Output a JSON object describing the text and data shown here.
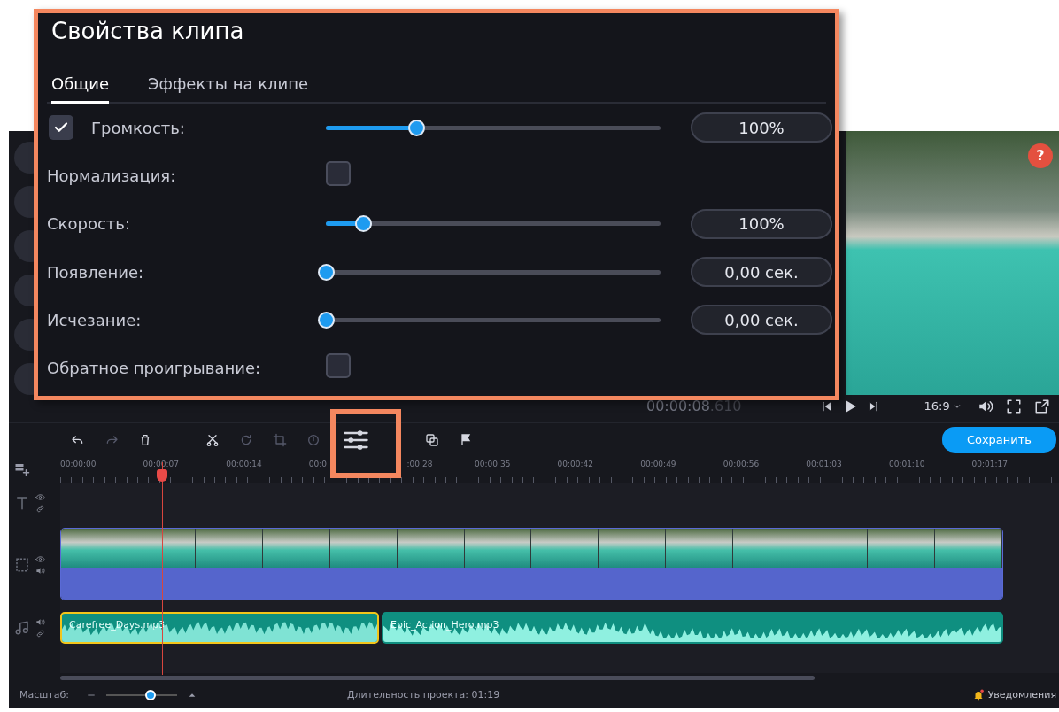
{
  "clip_properties": {
    "title": "Свойства клипа",
    "tabs": [
      {
        "label": "Общие",
        "selected": true
      },
      {
        "label": "Эффекты на клипе",
        "selected": false
      }
    ],
    "rows": [
      {
        "kind": "checkbox-slider",
        "label": "Громкость:",
        "checked": true,
        "level": 0.27,
        "value": "100%"
      },
      {
        "kind": "checkbox",
        "label": "Нормализация:",
        "checked": false
      },
      {
        "kind": "slider",
        "label": "Скорость:",
        "level": 0.11,
        "value": "100%"
      },
      {
        "kind": "slider",
        "label": "Появление:",
        "level": 0,
        "value": "0,00 сек."
      },
      {
        "kind": "slider",
        "label": "Исчезание:",
        "level": 0,
        "value": "0,00 сек."
      },
      {
        "kind": "checkbox",
        "label": "Обратное проигрывание:",
        "checked": false
      }
    ]
  },
  "preview": {
    "help": "?"
  },
  "player": {
    "time": "00:00:08",
    "time_fraction": ".610",
    "aspect": "16:9"
  },
  "toolbar": {
    "save_button": "Сохранить"
  },
  "ruler": {
    "ticks": [
      {
        "label": "00:00:00"
      },
      {
        "label": "00:00:07"
      },
      {
        "label": "00:00:14"
      },
      {
        "label": "00:0"
      },
      {
        "label": ":00:28",
        "cut_start": true
      },
      {
        "label": "00:00:35"
      },
      {
        "label": "00:00:42"
      },
      {
        "label": "00:00:49"
      },
      {
        "label": "00:00:56"
      },
      {
        "label": "00:01:03"
      },
      {
        "label": "00:01:10"
      },
      {
        "label": "00:01:17"
      }
    ]
  },
  "timeline": {
    "audio_clips": [
      {
        "name": "Carefree_Days.mp3",
        "selected": true
      },
      {
        "name": "Epic_Action_Hero.mp3",
        "selected": false
      }
    ]
  },
  "status_bar": {
    "zoom": {
      "label": "Масштаб:",
      "level": 0.62
    },
    "duration": "Длительность проекта: 01:19",
    "notifications": "Уведомления"
  }
}
